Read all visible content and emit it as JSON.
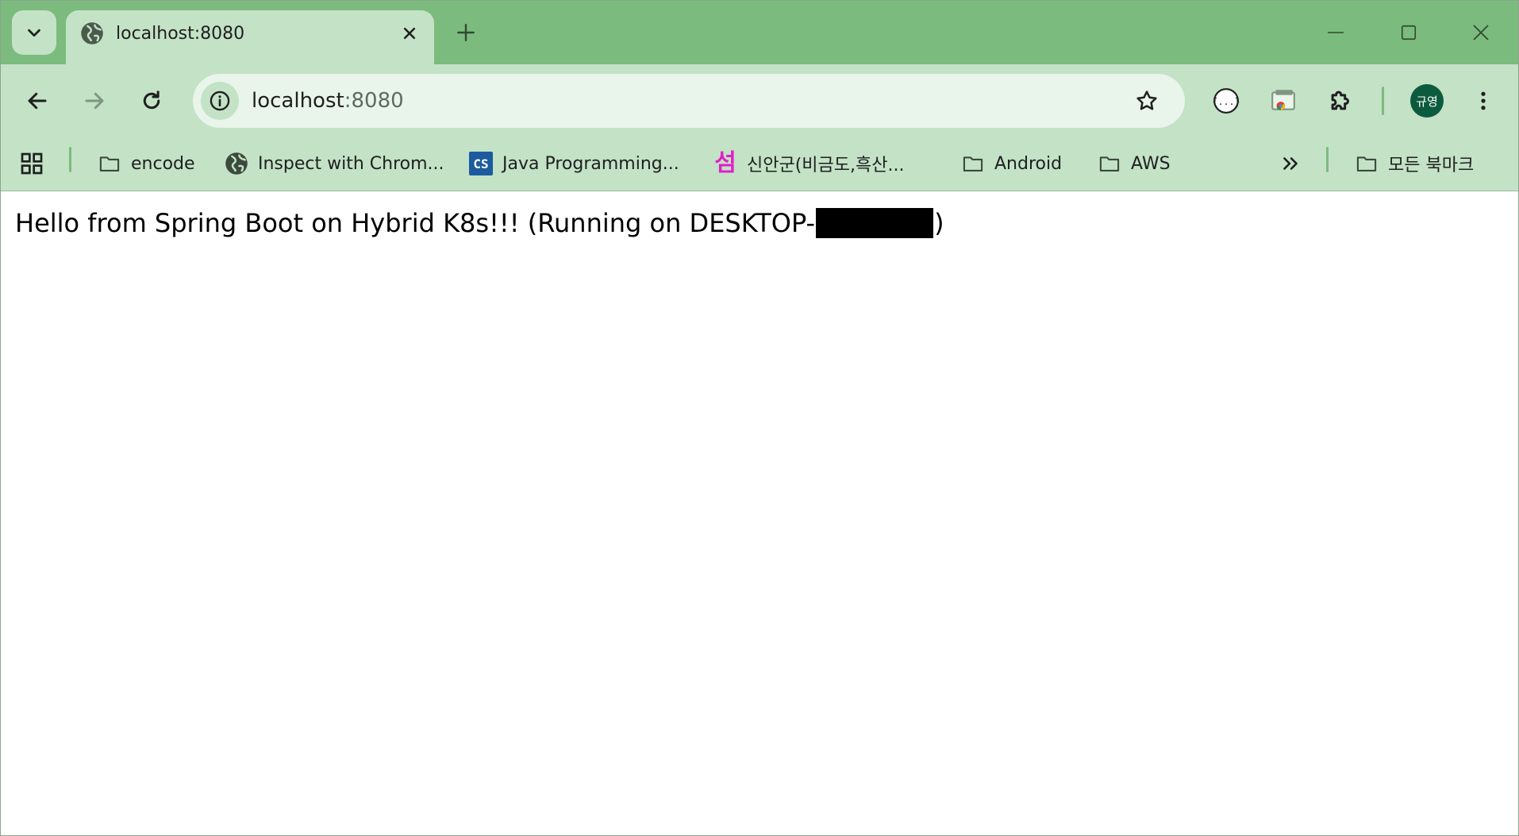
{
  "tab": {
    "title": "localhost:8080",
    "favicon": "globe-icon"
  },
  "address_bar": {
    "host": "localhost",
    "port": ":8080"
  },
  "profile": {
    "initials": "규영"
  },
  "bookmarks": [
    {
      "label": "encode",
      "icon": "folder-icon"
    },
    {
      "label": "Inspect with Chrom...",
      "icon": "globe-icon"
    },
    {
      "label": "Java Programming...",
      "icon": "cs-icon",
      "icon_text": "CS"
    },
    {
      "label": "신안군(비금도,흑산...",
      "icon": "seom-icon",
      "icon_text": "섬"
    },
    {
      "label": "Android",
      "icon": "folder-icon"
    },
    {
      "label": "AWS",
      "icon": "folder-icon"
    }
  ],
  "all_bookmarks_label": "모든 북마크",
  "page": {
    "message_prefix": "Hello from Spring Boot on Hybrid K8s!!! (Running on DESKTOP-",
    "message_suffix": ")"
  },
  "colors": {
    "frame": "#7cbb7e",
    "toolbar": "#c3e2c6",
    "omnibox": "#e9f4ea",
    "avatar": "#0d5b3e"
  }
}
